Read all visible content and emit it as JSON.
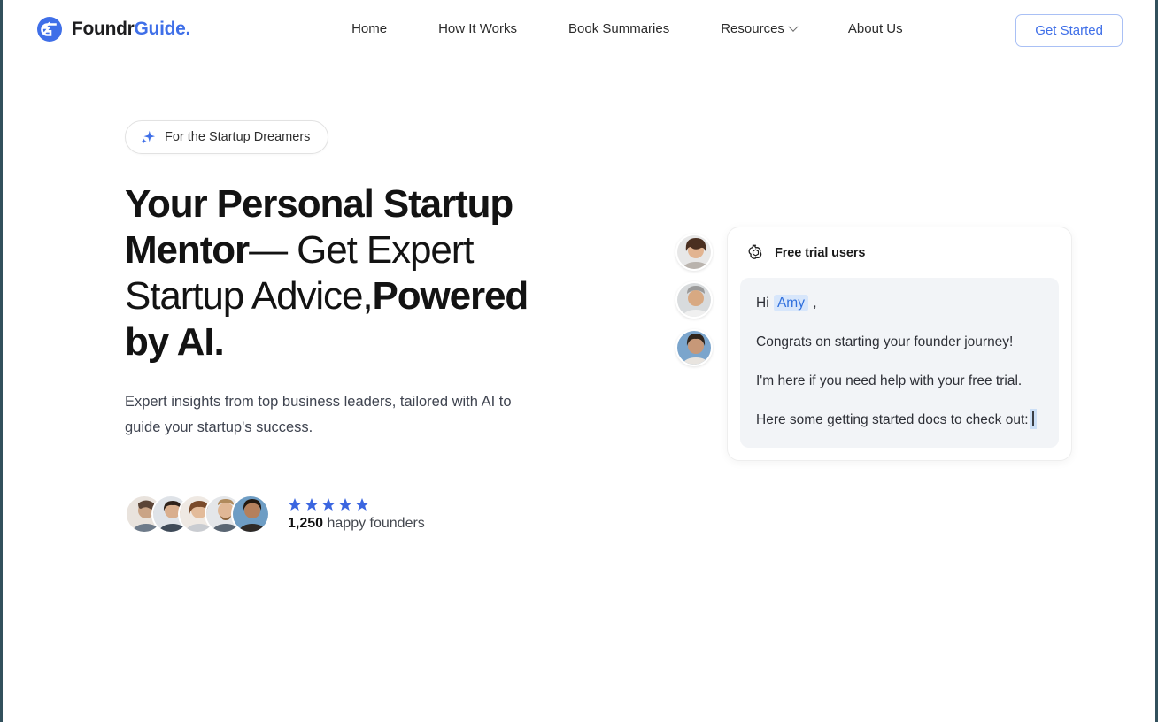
{
  "header": {
    "logo_icon": "foundrguide-logo-icon",
    "brand": {
      "part1": "Foundr",
      "part2": "Guide",
      "part3": "."
    },
    "nav": [
      {
        "label": "Home",
        "has_dropdown": false
      },
      {
        "label": "How It Works",
        "has_dropdown": false
      },
      {
        "label": "Book Summaries",
        "has_dropdown": false
      },
      {
        "label": "Resources",
        "has_dropdown": true
      },
      {
        "label": "About Us",
        "has_dropdown": false
      }
    ],
    "cta_label": "Get Started"
  },
  "hero": {
    "badge": {
      "icon": "sparkle-icon",
      "label": "For the Startup Dreamers"
    },
    "headline": {
      "bold1": "Your Personal Startup Mentor",
      "normal1": "— Get Expert Startup Advice,",
      "bold2": "Powered by AI."
    },
    "subtitle": "Expert insights from top business leaders, tailored with AI to guide your startup's success.",
    "social_proof": {
      "avatar_count": 5,
      "star_count": 5,
      "star_color": "#3b66e0",
      "count": "1,250",
      "label": "happy founders"
    }
  },
  "chat": {
    "side_avatar_count": 3,
    "header": {
      "icon": "openai-logo-icon",
      "title": "Free trial users"
    },
    "message": {
      "greeting_prefix": "Hi",
      "mention": "Amy",
      "greeting_suffix": ",",
      "lines": [
        "Congrats on starting your founder journey!",
        "I'm here if you need help with your free trial.",
        "Here some getting started docs to check out:"
      ]
    }
  },
  "colors": {
    "accent": "#3f6fe8",
    "mention_bg": "#d7e6fb",
    "mention_text": "#2f6fdd",
    "bubble_bg": "#f2f4f7",
    "frame": "#32505c"
  }
}
